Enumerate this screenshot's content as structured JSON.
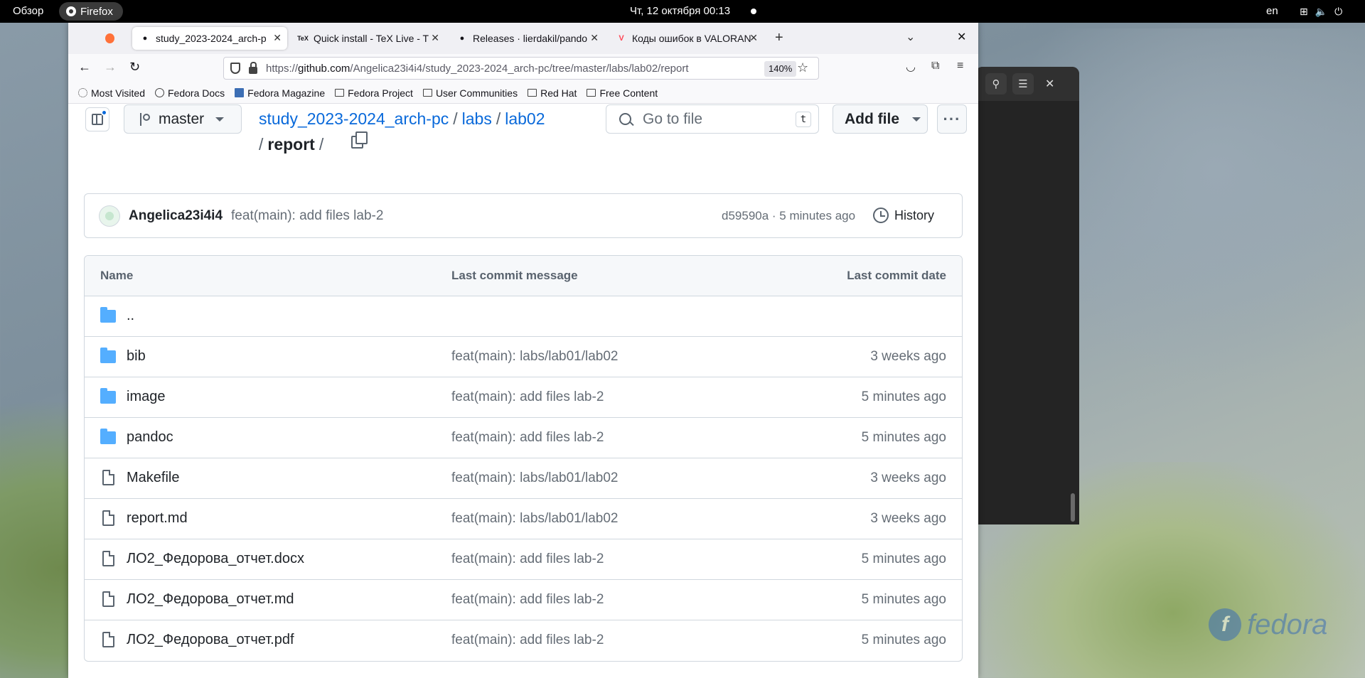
{
  "system_bar": {
    "overview": "Обзор",
    "app_name": "Firefox",
    "clock": "Чт, 12 октября  00:13",
    "lang": "en",
    "tray_icons": [
      "network-icon",
      "volume-icon",
      "power-icon"
    ]
  },
  "browser": {
    "tabs": [
      {
        "label": "study_2023-2024_arch-p",
        "icon": "github-icon",
        "active": true
      },
      {
        "label": "Quick install - TeX Live - T",
        "icon": "tex-icon",
        "active": false
      },
      {
        "label": "Releases · lierdakil/pando",
        "icon": "github-icon",
        "active": false
      },
      {
        "label": "Коды ошибок в VALORAN",
        "icon": "valorant-icon",
        "active": false
      }
    ],
    "url_prefix": "https://",
    "url_host": "github.com",
    "url_path": "/Angelica23i4i4/study_2023-2024_arch-pc/tree/master/labs/lab02/report",
    "zoom": "140%",
    "bookmarks": [
      {
        "label": "Most Visited",
        "icon": "gear"
      },
      {
        "label": "Fedora Docs",
        "icon": "globe"
      },
      {
        "label": "Fedora Magazine",
        "icon": "fm"
      },
      {
        "label": "Fedora Project",
        "icon": "folder"
      },
      {
        "label": "User Communities",
        "icon": "folder"
      },
      {
        "label": "Red Hat",
        "icon": "folder"
      },
      {
        "label": "Free Content",
        "icon": "folder"
      }
    ]
  },
  "repo": {
    "branch": "master",
    "breadcrumb": {
      "repo": "study_2023-2024_arch-pc",
      "seg1": "labs",
      "seg2": "lab02",
      "current": "report"
    },
    "go_to_file_placeholder": "Go to file",
    "go_to_file_key": "t",
    "add_file": "Add file",
    "commit": {
      "author": "Angelica23i4i4",
      "message": "feat(main): add files lab-2",
      "sha_time": "d59590a · 5 minutes ago",
      "history": "History"
    },
    "table": {
      "headers": {
        "name": "Name",
        "message": "Last commit message",
        "date": "Last commit date"
      },
      "rows": [
        {
          "type": "folder",
          "name": "..",
          "message": "",
          "date": ""
        },
        {
          "type": "folder",
          "name": "bib",
          "message": "feat(main): labs/lab01/lab02",
          "date": "3 weeks ago"
        },
        {
          "type": "folder",
          "name": "image",
          "message": "feat(main): add files lab-2",
          "date": "5 minutes ago"
        },
        {
          "type": "folder",
          "name": "pandoc",
          "message": "feat(main): add files lab-2",
          "date": "5 minutes ago"
        },
        {
          "type": "file",
          "name": "Makefile",
          "message": "feat(main): labs/lab01/lab02",
          "date": "3 weeks ago"
        },
        {
          "type": "file",
          "name": "report.md",
          "message": "feat(main): labs/lab01/lab02",
          "date": "3 weeks ago"
        },
        {
          "type": "file",
          "name": "ЛО2_Федорова_отчет.docx",
          "message": "feat(main): add files lab-2",
          "date": "5 minutes ago"
        },
        {
          "type": "file",
          "name": "ЛО2_Федорова_отчет.md",
          "message": "feat(main): add files lab-2",
          "date": "5 minutes ago"
        },
        {
          "type": "file",
          "name": "ЛО2_Федорова_отчет.pdf",
          "message": "feat(main): add files lab-2",
          "date": "5 minutes ago"
        }
      ]
    }
  },
  "wallpaper": {
    "logo_text": "fedora",
    "logo_letter": "f"
  }
}
